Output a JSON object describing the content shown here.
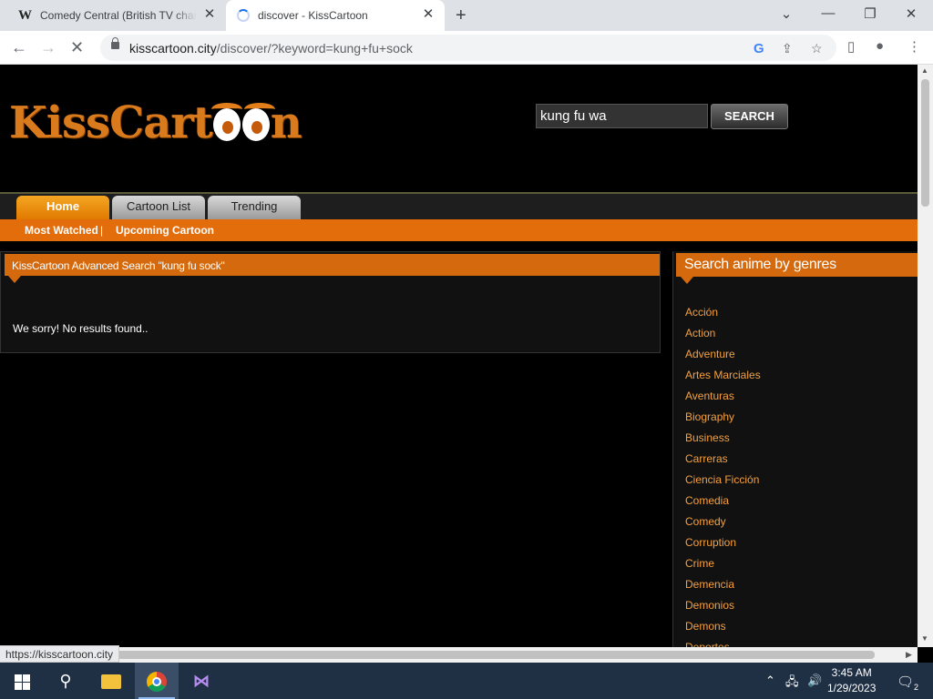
{
  "browser": {
    "tabs": [
      {
        "title": "Comedy Central (British TV channel)",
        "favicon": "W"
      },
      {
        "title": "discover - KissCartoon"
      }
    ],
    "url_domain": "kisscartoon.city",
    "url_path": "/discover/?keyword=kung+fu+sock",
    "status_url": "https://kisscartoon.city"
  },
  "site": {
    "logo_text": "KissCart",
    "logo_tail": "n",
    "search_value": "kung fu wa",
    "search_button": "SEARCH",
    "menu": {
      "home": "Home",
      "cartoon_list": "Cartoon List",
      "trending": "Trending"
    },
    "submenu": {
      "most_watched": "Most Watched",
      "separator": "|",
      "upcoming": "Upcoming Cartoon"
    }
  },
  "main": {
    "heading": "KissCartoon Advanced Search \"kung fu sock\"",
    "message": "We sorry! No results found.."
  },
  "sidebar": {
    "heading": "Search anime by genres",
    "genres": [
      "Acción",
      "Action",
      "Adventure",
      "Artes Marciales",
      "Aventuras",
      "Biography",
      "Business",
      "Carreras",
      "Ciencia Ficción",
      "Comedia",
      "Comedy",
      "Corruption",
      "Crime",
      "Demencia",
      "Demonios",
      "Demons",
      "Deportes"
    ]
  },
  "taskbar": {
    "time": "3:45 AM",
    "date": "1/29/2023",
    "notifications": "2"
  }
}
